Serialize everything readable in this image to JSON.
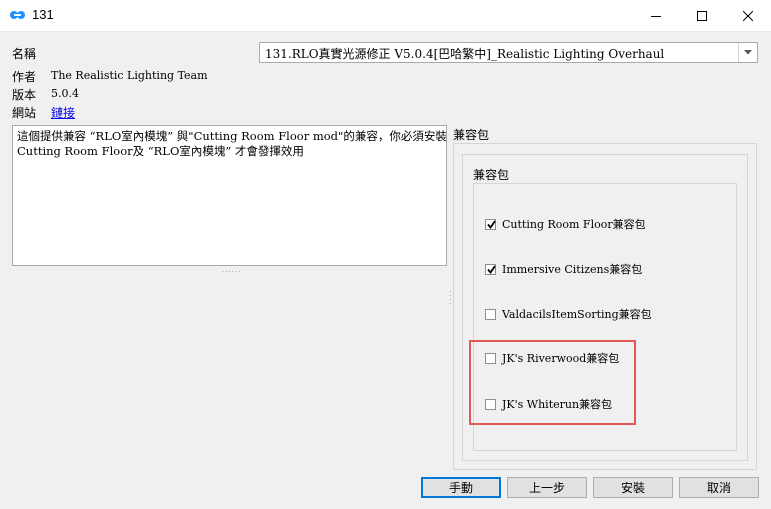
{
  "window": {
    "title": "131",
    "icon": "link-icon",
    "controls": [
      "minimize-icon",
      "maximize-icon",
      "close-icon"
    ]
  },
  "info": {
    "name_label": "名稱",
    "author_label": "作者",
    "author_value": "The Realistic Lighting Team",
    "version_label": "版本",
    "version_value": "5.0.4",
    "website_label": "網站",
    "website_link": "鏈接"
  },
  "mod_select": {
    "value": "131.RLO真實光源修正 V5.0.4[巴哈繁中]_Realistic Lighting Overhaul"
  },
  "description": {
    "lines": [
      "這個提供兼容 “RLO室內模塊” 與\"Cutting Room Floor mod\"的兼容，你必須安裝",
      "Cutting Room Floor及 “RLO室內模塊” 才會發揮效用"
    ]
  },
  "compat": {
    "outer_label": "兼容包",
    "inner_label": "兼容包",
    "options": [
      {
        "label": "Cutting Room Floor兼容包",
        "checked": true
      },
      {
        "label": "Immersive Citizens兼容包",
        "checked": true
      },
      {
        "label": "ValdacilsItemSorting兼容包",
        "checked": false
      },
      {
        "label": "JK's Riverwood兼容包",
        "checked": false
      },
      {
        "label": "JK's Whiterun兼容包",
        "checked": false
      }
    ]
  },
  "buttons": {
    "manual": "手動",
    "back": "上一步",
    "install": "安裝",
    "cancel": "取消"
  },
  "colors": {
    "highlight": "#e05a55",
    "link": "#0000ee",
    "primary_border": "#0078d7"
  }
}
